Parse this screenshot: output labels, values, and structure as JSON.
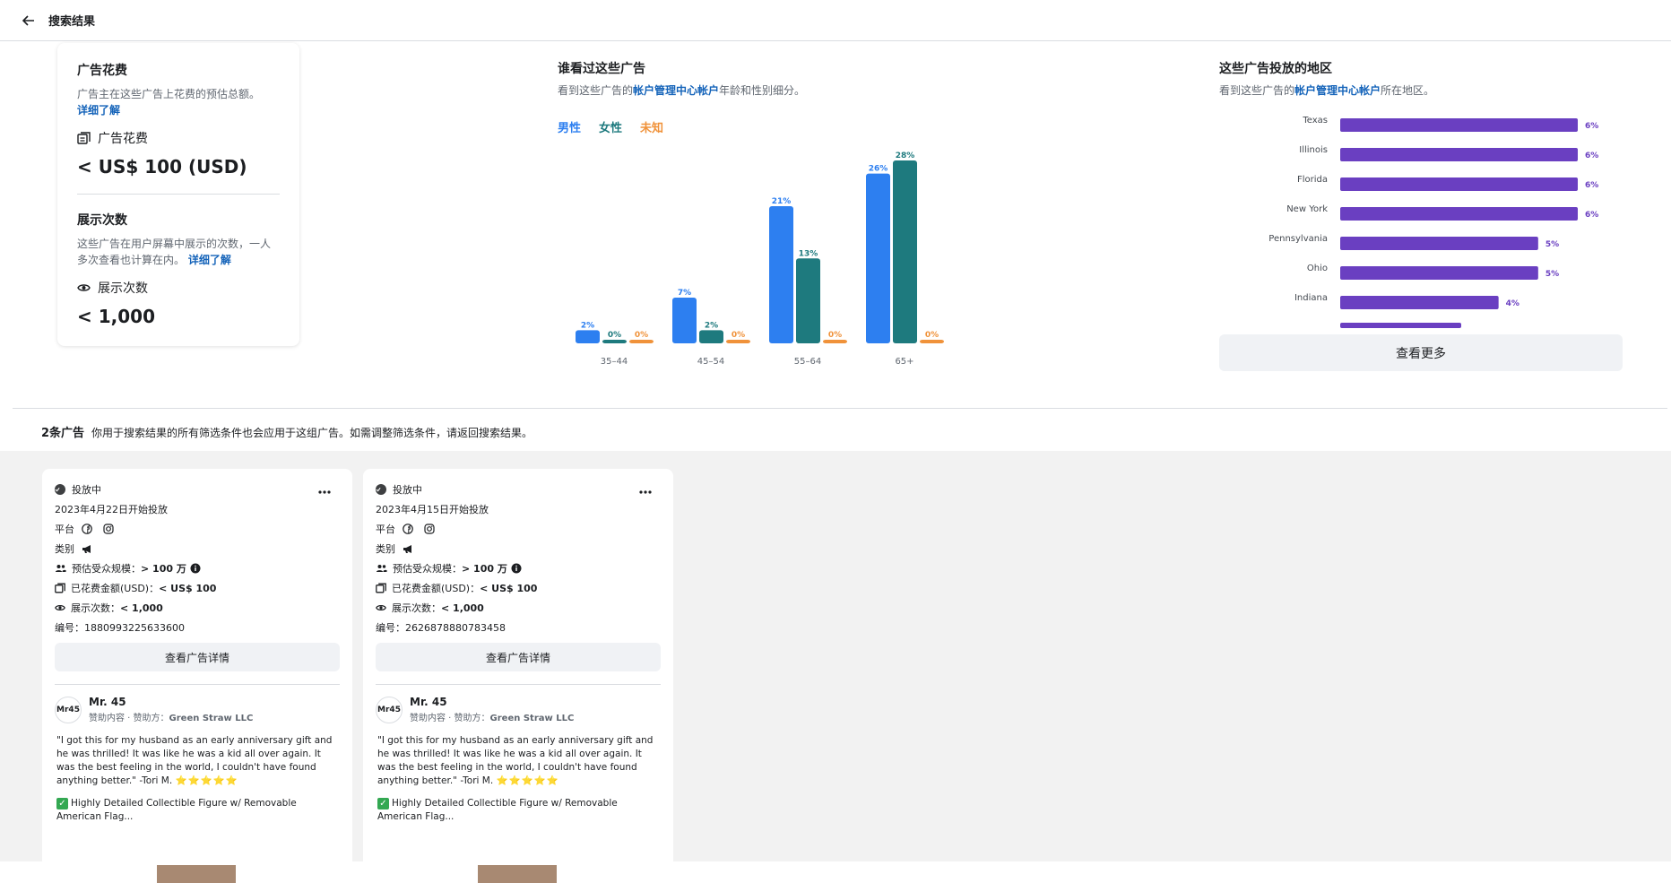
{
  "header": {
    "title": "搜索结果"
  },
  "spend": {
    "title": "广告花费",
    "desc": "广告主在这些广告上花费的预估总额。",
    "learn_more": "详细了解",
    "label": "广告花费",
    "value": "< US$ 100 (USD)"
  },
  "impressions": {
    "title": "展示次数",
    "desc": "这些广告在用户屏幕中展示的次数，一人多次查看也计算在内。",
    "learn_more": "详细了解",
    "label": "展示次数",
    "value": "< 1,000"
  },
  "gender": {
    "title": "谁看过这些广告",
    "desc_prefix": "看到这些广告的",
    "desc_link": "帐户管理中心帐户",
    "desc_suffix": "年龄和性别细分。",
    "legend": {
      "male": "男性",
      "female": "女性",
      "unknown": "未知"
    }
  },
  "region": {
    "title": "这些广告投放的地区",
    "desc_prefix": "看到这些广告的",
    "desc_link": "帐户管理中心帐户",
    "desc_suffix": "所在地区。",
    "more_button": "查看更多"
  },
  "colors": {
    "male": "#2d7ff0",
    "female": "#1e7a7e",
    "unknown": "#f0923a",
    "region": "#6a3fc1"
  },
  "chart_data": [
    {
      "type": "bar",
      "categories": [
        "35–44",
        "45–54",
        "55–64",
        "65+"
      ],
      "series": [
        {
          "name": "男性",
          "values": [
            2,
            7,
            21,
            26
          ]
        },
        {
          "name": "女性",
          "values": [
            0,
            2,
            13,
            28
          ]
        },
        {
          "name": "未知",
          "values": [
            0,
            0,
            0,
            0
          ]
        }
      ],
      "ylim": [
        0,
        28
      ]
    },
    {
      "type": "bar",
      "orientation": "horizontal",
      "categories": [
        "Texas",
        "Illinois",
        "Florida",
        "New York",
        "Pennsylvania",
        "Ohio",
        "Indiana"
      ],
      "values": [
        6,
        6,
        6,
        6,
        5,
        5,
        4
      ],
      "xlim": [
        0,
        6
      ]
    }
  ],
  "results": {
    "count": "2条广告",
    "note": "你用于搜索结果的所有筛选条件也会应用于这组广告。如需调整筛选条件，请返回搜索结果。"
  },
  "ads": [
    {
      "status": "投放中",
      "start": "2023年4月22日开始投放",
      "platform_label": "平台",
      "category_label": "类别",
      "audience_label": "预估受众规模：",
      "audience_value": "> 100 万",
      "spend_label": "已花费金额(USD)：",
      "spend_value": "< US$ 100",
      "impr_label": "展示次数：",
      "impr_value": "< 1,000",
      "id_label": "编号：",
      "id_value": "1880993225633600",
      "detail_button": "查看广告详情",
      "page_name": "Mr. 45",
      "avatar_text": "Mr45",
      "sponsored": "赞助内容 · 赞助方：",
      "sponsor": "Green Straw LLC",
      "text1": "\"I got this for my husband as an early anniversary gift and he was thrilled! It was like he was a kid all over again. It was the best feeling in the world, I couldn't have found anything better.\" -Tori M.",
      "stars": "⭐⭐⭐⭐⭐",
      "text2": "Highly Detailed Collectible Figure w/ Removable American Flag..."
    },
    {
      "status": "投放中",
      "start": "2023年4月15日开始投放",
      "platform_label": "平台",
      "category_label": "类别",
      "audience_label": "预估受众规模：",
      "audience_value": "> 100 万",
      "spend_label": "已花费金额(USD)：",
      "spend_value": "< US$ 100",
      "impr_label": "展示次数：",
      "impr_value": "< 1,000",
      "id_label": "编号：",
      "id_value": "2626878880783458",
      "detail_button": "查看广告详情",
      "page_name": "Mr. 45",
      "avatar_text": "Mr45",
      "sponsored": "赞助内容 · 赞助方：",
      "sponsor": "Green Straw LLC",
      "text1": "\"I got this for my husband as an early anniversary gift and he was thrilled! It was like he was a kid all over again. It was the best feeling in the world, I couldn't have found anything better.\" -Tori M.",
      "stars": "⭐⭐⭐⭐⭐",
      "text2": "Highly Detailed Collectible Figure w/ Removable American Flag..."
    }
  ]
}
